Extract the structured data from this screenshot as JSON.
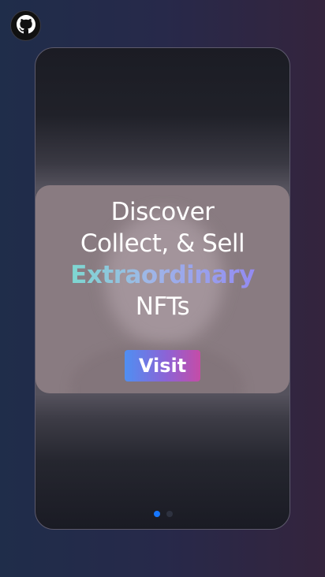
{
  "github": {
    "icon": "github-icon",
    "color": "#111111"
  },
  "hero": {
    "line1": "Discover",
    "line2": "Collect, & Sell",
    "highlight": "Extraordinary",
    "line4": "NFTs",
    "button_label": "Visit"
  },
  "carousel": {
    "slide_count": 2,
    "active_index": 0,
    "active_color": "#1677ff"
  },
  "colors": {
    "gradient_start": "#6ee7c6",
    "gradient_end": "#8f7cf4",
    "button_start": "#4f8ff2",
    "button_end": "#c54ca7"
  }
}
